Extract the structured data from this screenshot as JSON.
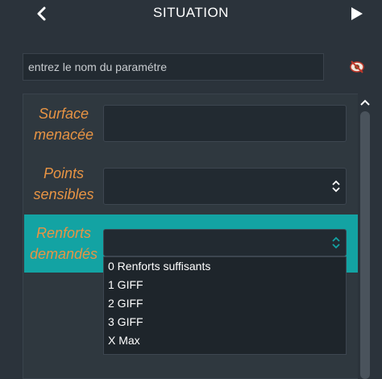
{
  "header": {
    "title": "SITUATION",
    "back_icon": "chevron-left-icon",
    "next_icon": "play-icon"
  },
  "search": {
    "placeholder": "entrez le nom du paramétre",
    "eye_icon": "eye-slash-icon"
  },
  "form": {
    "fields": [
      {
        "label_line1": "Surface",
        "label_line2": "menacée",
        "type": "text",
        "value": ""
      },
      {
        "label_line1": "Points",
        "label_line2": "sensibles",
        "type": "select",
        "value": ""
      },
      {
        "label_line1": "Renforts",
        "label_line2": "demandés",
        "type": "select",
        "value": "",
        "active": true
      }
    ]
  },
  "dropdown": {
    "options": [
      "0 Renforts suffisants",
      "1 GIFF",
      "2 GIFF",
      "3 GIFF",
      "X Max"
    ]
  },
  "colors": {
    "background": "#2b333b",
    "accent_teal": "#13a3a3",
    "label_orange": "#e89444",
    "field_bg": "#222a31"
  }
}
